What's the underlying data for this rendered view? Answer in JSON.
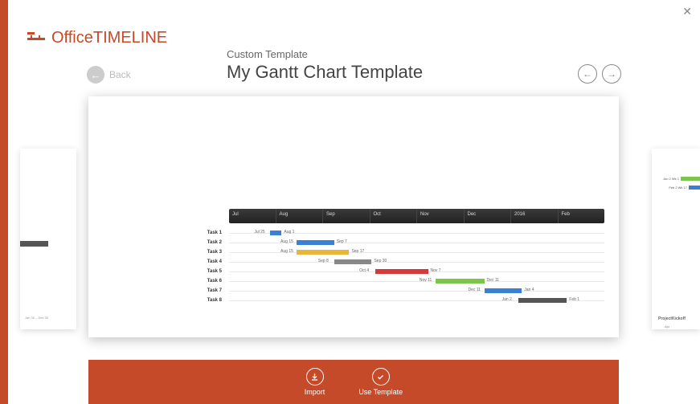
{
  "app": {
    "logo_a": "Office",
    "logo_b": "TIMELINE"
  },
  "close": "✕",
  "back": {
    "label": "Back"
  },
  "header": {
    "subtitle": "Custom Template",
    "title": "My Gantt Chart Template"
  },
  "nav": {
    "prev": "←",
    "next": "→"
  },
  "neighbor_right": {
    "title": "ProjectKickoff",
    "rows": [
      {
        "label": "Jun 2  Wk 1",
        "color": "#7cc44a",
        "w": 24
      },
      {
        "label": "Feb 2  Wk 17",
        "color": "#3a7fd4",
        "w": 14
      }
    ],
    "axis": "Apr"
  },
  "chart_data": {
    "type": "gantt",
    "timescale": [
      "Jul",
      "Aug",
      "Sep",
      "Oct",
      "Nov",
      "Dec",
      "2016",
      "Feb"
    ],
    "tasks": [
      {
        "name": "Task 1",
        "start_label": "Jul 25",
        "end_label": "Aug 1",
        "start_pct": 11,
        "width_pct": 3,
        "color": "#3a7fd4"
      },
      {
        "name": "Task 2",
        "start_label": "Aug 15",
        "end_label": "Sep 7",
        "start_pct": 18,
        "width_pct": 10,
        "color": "#3a7fd4"
      },
      {
        "name": "Task 3",
        "start_label": "Aug 15",
        "end_label": "Sep 17",
        "start_pct": 18,
        "width_pct": 14,
        "color": "#e8b73a"
      },
      {
        "name": "Task 4",
        "start_label": "Sep 8",
        "end_label": "Sep 30",
        "start_pct": 28,
        "width_pct": 10,
        "color": "#888"
      },
      {
        "name": "Task 5",
        "start_label": "Oct 4",
        "end_label": "Nov 7",
        "start_pct": 39,
        "width_pct": 14,
        "color": "#d43a3a"
      },
      {
        "name": "Task 6",
        "start_label": "Nov 11",
        "end_label": "Dec 11",
        "start_pct": 55,
        "width_pct": 13,
        "color": "#7cc44a"
      },
      {
        "name": "Task 7",
        "start_label": "Dec 11",
        "end_label": "Jan 4",
        "start_pct": 68,
        "width_pct": 10,
        "color": "#3a7fd4"
      },
      {
        "name": "Task 8",
        "start_label": "Jan 2",
        "end_label": "Feb 1",
        "start_pct": 77,
        "width_pct": 13,
        "color": "#555"
      }
    ]
  },
  "footer": {
    "import": "Import",
    "use": "Use Template"
  },
  "left_preview": {
    "footer": "Jan 30 – Dec 30"
  }
}
